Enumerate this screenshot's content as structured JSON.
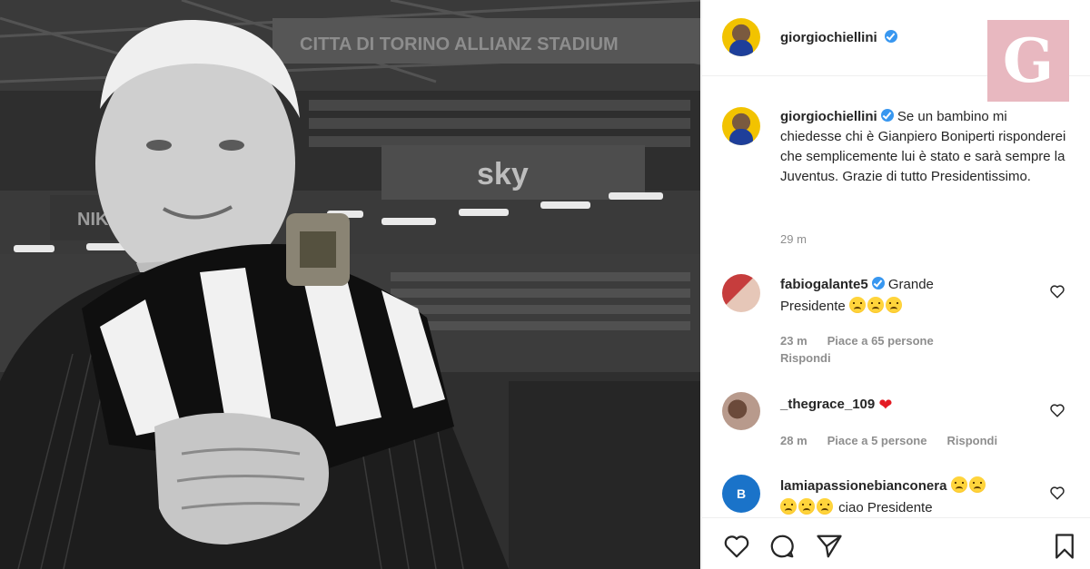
{
  "photo": {
    "alt_stadium_sign": "sky",
    "banner_text": "CITTA DI TORINO ALLIANZ STADIUM",
    "sponsor_text": "NIKE"
  },
  "post": {
    "author": "giorgiochiellini",
    "verified": true,
    "more_label": "···",
    "logo_letter": "G",
    "caption": "Se un bambino mi chiedesse chi è Gianpiero Boniperti risponderei che semplicemente lui è stato e sarà sempre la Juventus. Grazie di tutto Presidentissimo.",
    "caption_time": "29 m"
  },
  "comments": [
    {
      "username": "fabiogalante5",
      "verified": true,
      "text_a": "Grande",
      "text_b": "Presidente",
      "time": "23 m",
      "likes": "Piace a 65 persone",
      "reply": "Rispondi"
    },
    {
      "username": "_thegrace_109",
      "verified": false,
      "time": "28 m",
      "likes": "Piace a 5 persone",
      "reply": "Rispondi"
    },
    {
      "username": "lamiapassionebianconera",
      "verified": false,
      "text": "ciao Presidente",
      "avatar_letter": "B"
    }
  ],
  "colors": {
    "verified": "#3897f0",
    "heart": "#e31b23",
    "logo_bg": "#e8b8c0"
  }
}
